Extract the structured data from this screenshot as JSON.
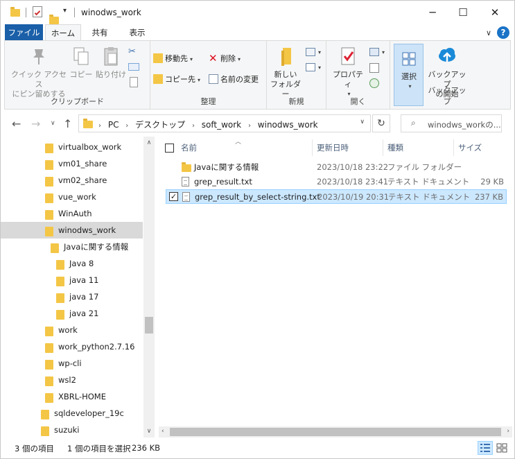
{
  "window": {
    "title": "winodws_work",
    "minimize": "─",
    "maximize": "☐",
    "close": "✕"
  },
  "ribbon_tabs": [
    "ファイル",
    "ホーム",
    "共有",
    "表示"
  ],
  "ribbon": {
    "clipboard": {
      "pin_line1": "クイック アクセス",
      "pin_line2": "にピン留めする",
      "copy": "コピー",
      "paste": "貼り付け",
      "label": "クリップボード"
    },
    "organize": {
      "move_to": "移動先",
      "copy_to": "コピー先",
      "delete": "削除",
      "rename": "名前の変更",
      "label": "整理"
    },
    "new": {
      "new_folder_line1": "新しい",
      "new_folder_line2": "フォルダー",
      "label": "新規"
    },
    "open": {
      "properties": "プロパティ",
      "label": "開く"
    },
    "select": {
      "select": "選択"
    },
    "backup": {
      "line1": "バックアップ",
      "line2": "の開始",
      "label": "バックアップ"
    }
  },
  "address": {
    "crumbs": [
      "PC",
      "デスクトップ",
      "soft_work",
      "winodws_work"
    ],
    "search_placeholder": "winodws_workの..."
  },
  "nav_tree": [
    {
      "label": "virtualbox_work",
      "indent": 0
    },
    {
      "label": "vm01_share",
      "indent": 0
    },
    {
      "label": "vm02_share",
      "indent": 0
    },
    {
      "label": "vue_work",
      "indent": 0
    },
    {
      "label": "WinAuth",
      "indent": 0
    },
    {
      "label": "winodws_work",
      "indent": 0,
      "selected": true
    },
    {
      "label": "Javaに関する情報",
      "indent": 1
    },
    {
      "label": "Java 8",
      "indent": 2
    },
    {
      "label": "java 11",
      "indent": 2
    },
    {
      "label": "java 17",
      "indent": 2
    },
    {
      "label": "java 21",
      "indent": 2
    },
    {
      "label": "work",
      "indent": 0
    },
    {
      "label": "work_python2.7.16",
      "indent": 0
    },
    {
      "label": "wp-cli",
      "indent": 0
    },
    {
      "label": "wsl2",
      "indent": 0
    },
    {
      "label": "XBRL-HOME",
      "indent": 0
    },
    {
      "label": "sqldeveloper_19c",
      "indent": -1
    },
    {
      "label": "suzuki",
      "indent": -1
    }
  ],
  "columns": {
    "name": "名前",
    "modified": "更新日時",
    "type": "種類",
    "size": "サイズ"
  },
  "files": [
    {
      "name": "Javaに関する情報",
      "modified": "2023/10/18 23:22",
      "type": "ファイル フォルダー",
      "size": "",
      "kind": "folder"
    },
    {
      "name": "grep_result.txt",
      "modified": "2023/10/18 23:41",
      "type": "テキスト ドキュメント",
      "size": "29 KB",
      "kind": "doc"
    },
    {
      "name": "grep_result_by_select-string.txt",
      "modified": "2023/10/19 20:31",
      "type": "テキスト ドキュメント",
      "size": "237 KB",
      "kind": "doc",
      "selected": true
    }
  ],
  "status": {
    "item_count": "3 個の項目",
    "selection": "1 個の項目を選択",
    "selection_size": "236 KB"
  }
}
